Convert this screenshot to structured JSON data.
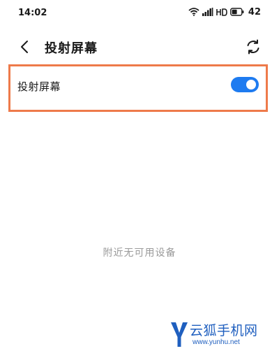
{
  "status_bar": {
    "time": "14:02",
    "battery": "42",
    "icons": [
      "wifi-icon",
      "signal-icon",
      "hd-icon",
      "battery-icon"
    ]
  },
  "header": {
    "title": "投射屏幕",
    "back_icon": "chevron-left-icon",
    "refresh_icon": "refresh-icon"
  },
  "setting": {
    "label": "投射屏幕",
    "enabled": true,
    "toggle_color": "#1e7bf0",
    "highlight_color": "#ee7a4a"
  },
  "empty_state": {
    "message": "附近无可用设备"
  },
  "watermark": {
    "name": "云狐手机网",
    "url": "www.yunhu.net",
    "color": "#1f5fbf"
  }
}
